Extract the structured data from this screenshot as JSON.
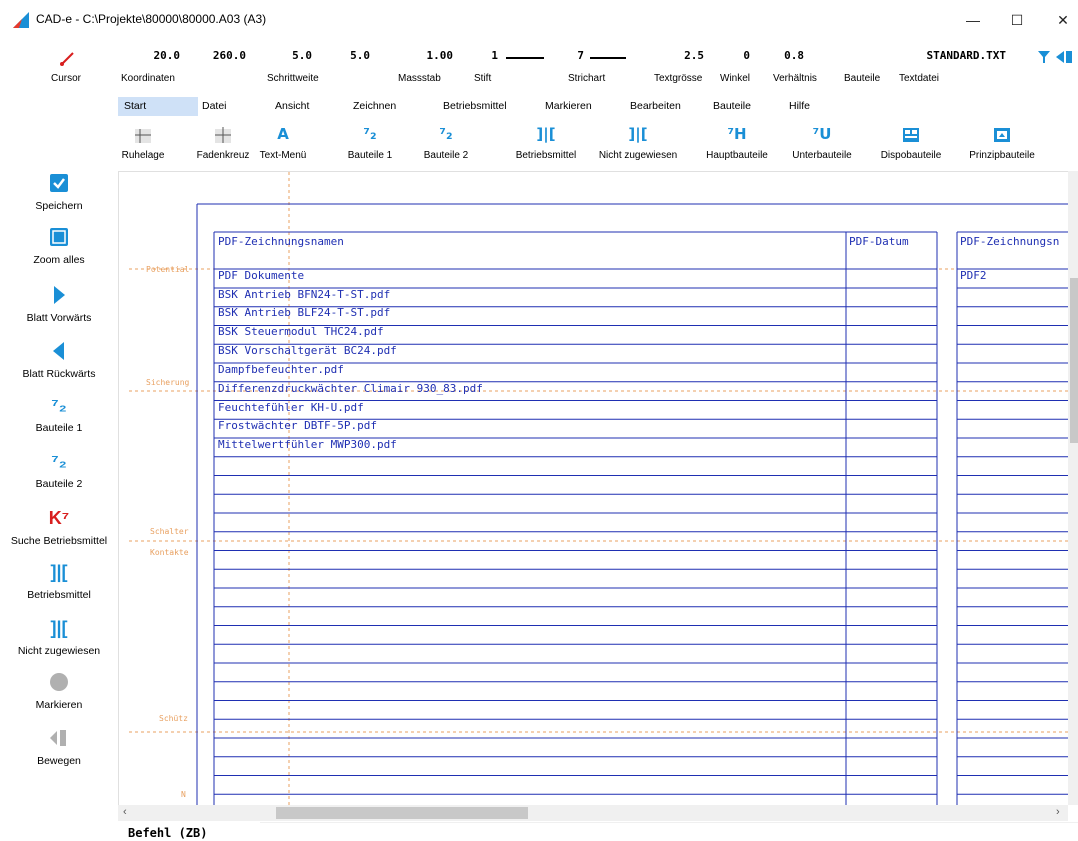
{
  "window": {
    "title": "CAD-e - C:\\Projekte\\80000\\80000.A03 (A3)",
    "minimize": "—",
    "maximize": "☐",
    "close": "✕"
  },
  "params": {
    "values": [
      "20.0",
      "260.0",
      "5.0",
      "5.0",
      "1.00",
      "1",
      "7",
      "2.5",
      "0",
      "0.8",
      "STANDARD.TXT"
    ],
    "labels": {
      "cursor": "Cursor",
      "koordinaten": "Koordinaten",
      "schrittweite": "Schrittweite",
      "massstab": "Massstab",
      "stift": "Stift",
      "strichart": "Strichart",
      "textgroesse": "Textgrösse",
      "winkel": "Winkel",
      "verhaeltnis": "Verhältnis",
      "bauteile": "Bauteile",
      "textdatei": "Textdatei"
    }
  },
  "menu": [
    "Start",
    "Datei",
    "Ansicht",
    "Zeichnen",
    "Betriebsmittel",
    "Markieren",
    "Bearbeiten",
    "Bauteile",
    "Hilfe"
  ],
  "toolbar": [
    "Ruhelage",
    "Fadenkreuz",
    "Text-Menü",
    "Bauteile 1",
    "Bauteile 2",
    "Betriebsmittel",
    "Nicht zugewiesen",
    "Hauptbauteile",
    "Unterbauteile",
    "Dispobauteile",
    "Prinzipbauteile"
  ],
  "sidebar": [
    "Speichern",
    "Zoom alles",
    "Blatt Vorwärts",
    "Blatt Rückwärts",
    "Bauteile 1",
    "Bauteile 2",
    "Suche Betriebsmittel",
    "Betriebsmittel",
    "Nicht zugewiesen",
    "Markieren",
    "Bewegen"
  ],
  "drawing": {
    "header": {
      "col1": "PDF-Zeichnungsnamen",
      "col2": "PDF-Datum",
      "col3": "PDF-Zeichnungsn"
    },
    "rows": [
      "PDF Dokumente",
      "BSK Antrieb BFN24-T-ST.pdf",
      "BSK Antrieb BLF24-T-ST.pdf",
      "BSK Steuermodul THC24.pdf",
      "BSK Vorschaltgerät BC24.pdf",
      "Dampfbefeuchter.pdf",
      "Differenzdruckwächter Climair 930_83.pdf",
      "Feuchtefühler KH-U.pdf",
      "Frostwächter DBTF-5P.pdf",
      "Mittelwertfühler MWP300.pdf"
    ],
    "col3_first": "PDF2",
    "side_labels": [
      "Potential",
      "Sicherung",
      "Schalter",
      "Kontakte",
      "Schütz",
      "N"
    ]
  },
  "command": "Befehl (ZB)",
  "colors": {
    "accent": "#1a8fd6",
    "drawing_line": "#1f2fb2",
    "guide": "#e8a060",
    "menu_active": "#cfe1f7",
    "red_icon": "#d81e1e"
  }
}
